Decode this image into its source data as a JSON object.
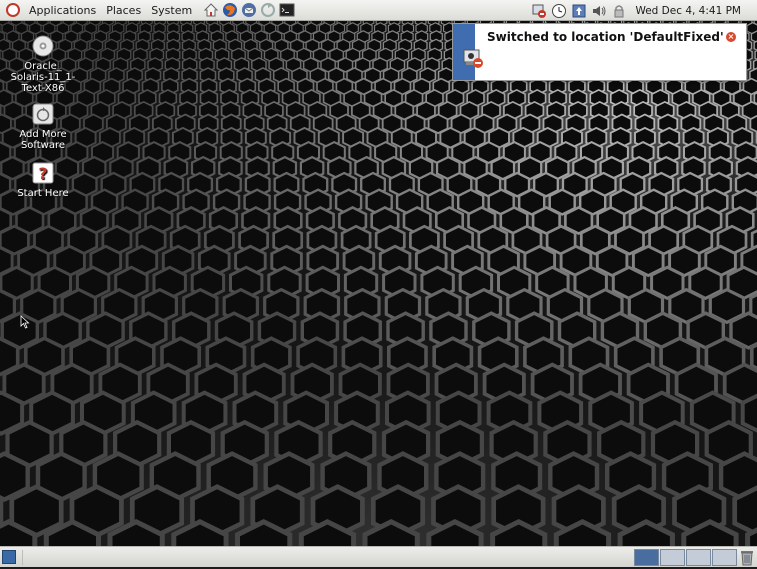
{
  "top_panel": {
    "menus": [
      "Applications",
      "Places",
      "System"
    ],
    "launchers": [
      "home-icon",
      "firefox-icon",
      "thunderbird-icon",
      "update-icon",
      "terminal-icon"
    ],
    "tray_icons": [
      "network-icon",
      "clock-applet-icon",
      "update-manager-icon",
      "volume-icon",
      "lock-icon"
    ],
    "clock": "Wed Dec  4,  4:41 PM"
  },
  "desktop": {
    "icons": [
      {
        "label": "Oracle_\nSolaris-11_1-\nText-X86",
        "icon": "cd-disc-icon"
      },
      {
        "label": "Add More\nSoftware",
        "icon": "software-package-icon"
      },
      {
        "label": "Start Here",
        "icon": "help-question-icon"
      }
    ]
  },
  "notification": {
    "message": "Switched to location 'DefaultFixed'",
    "accent_color": "#3f6db0"
  },
  "bottom_panel": {
    "workspace_count": 4,
    "active_workspace": 1
  },
  "colors": {
    "panel": "#e6e6e3",
    "desktop": "#161616",
    "close_button": "#d9482b"
  }
}
